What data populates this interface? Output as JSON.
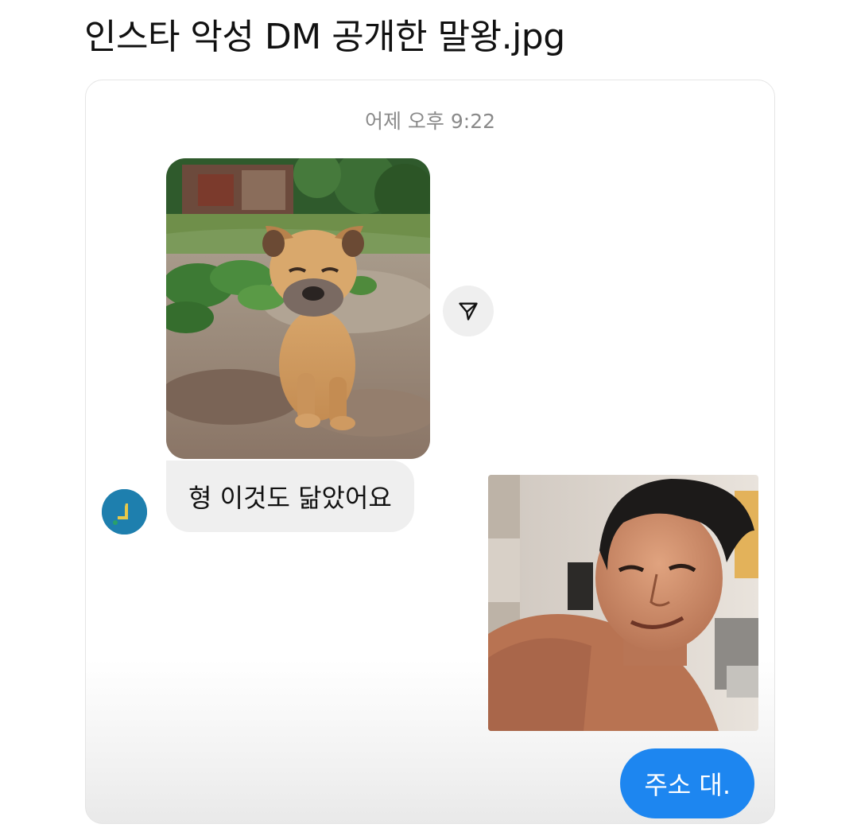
{
  "post": {
    "title": "인스타 악성 DM 공개한 말왕.jpg"
  },
  "conversation": {
    "timestamp": "어제 오후 9:22",
    "received_message": "형 이것도 닮았어요",
    "sent_message": "주소 대.",
    "share_icon": "paper-plane-icon",
    "colors": {
      "received_bubble": "#efefef",
      "sent_bubble": "#1d86f0",
      "avatar": "#1e7fae",
      "timestamp": "#8a8a8a"
    }
  }
}
